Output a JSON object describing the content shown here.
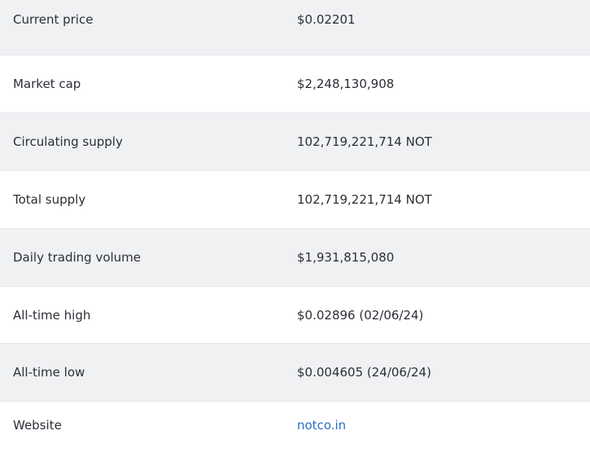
{
  "stats": {
    "rows": [
      {
        "label": "Current price",
        "value": "$0.02201"
      },
      {
        "label": "Market cap",
        "value": "$2,248,130,908"
      },
      {
        "label": "Circulating supply",
        "value": "102,719,221,714 NOT"
      },
      {
        "label": "Total supply",
        "value": "102,719,221,714 NOT"
      },
      {
        "label": "Daily trading volume",
        "value": "$1,931,815,080"
      },
      {
        "label": "All-time high",
        "value": "$0.02896 (02/06/24)"
      },
      {
        "label": "All-time low",
        "value": "$0.004605 (24/06/24)"
      },
      {
        "label": "Website",
        "value": "notco.in"
      }
    ]
  },
  "colors": {
    "shaded_row": "#f0f1f3",
    "link": "#2a6fc9",
    "text": "#2b2f36"
  }
}
